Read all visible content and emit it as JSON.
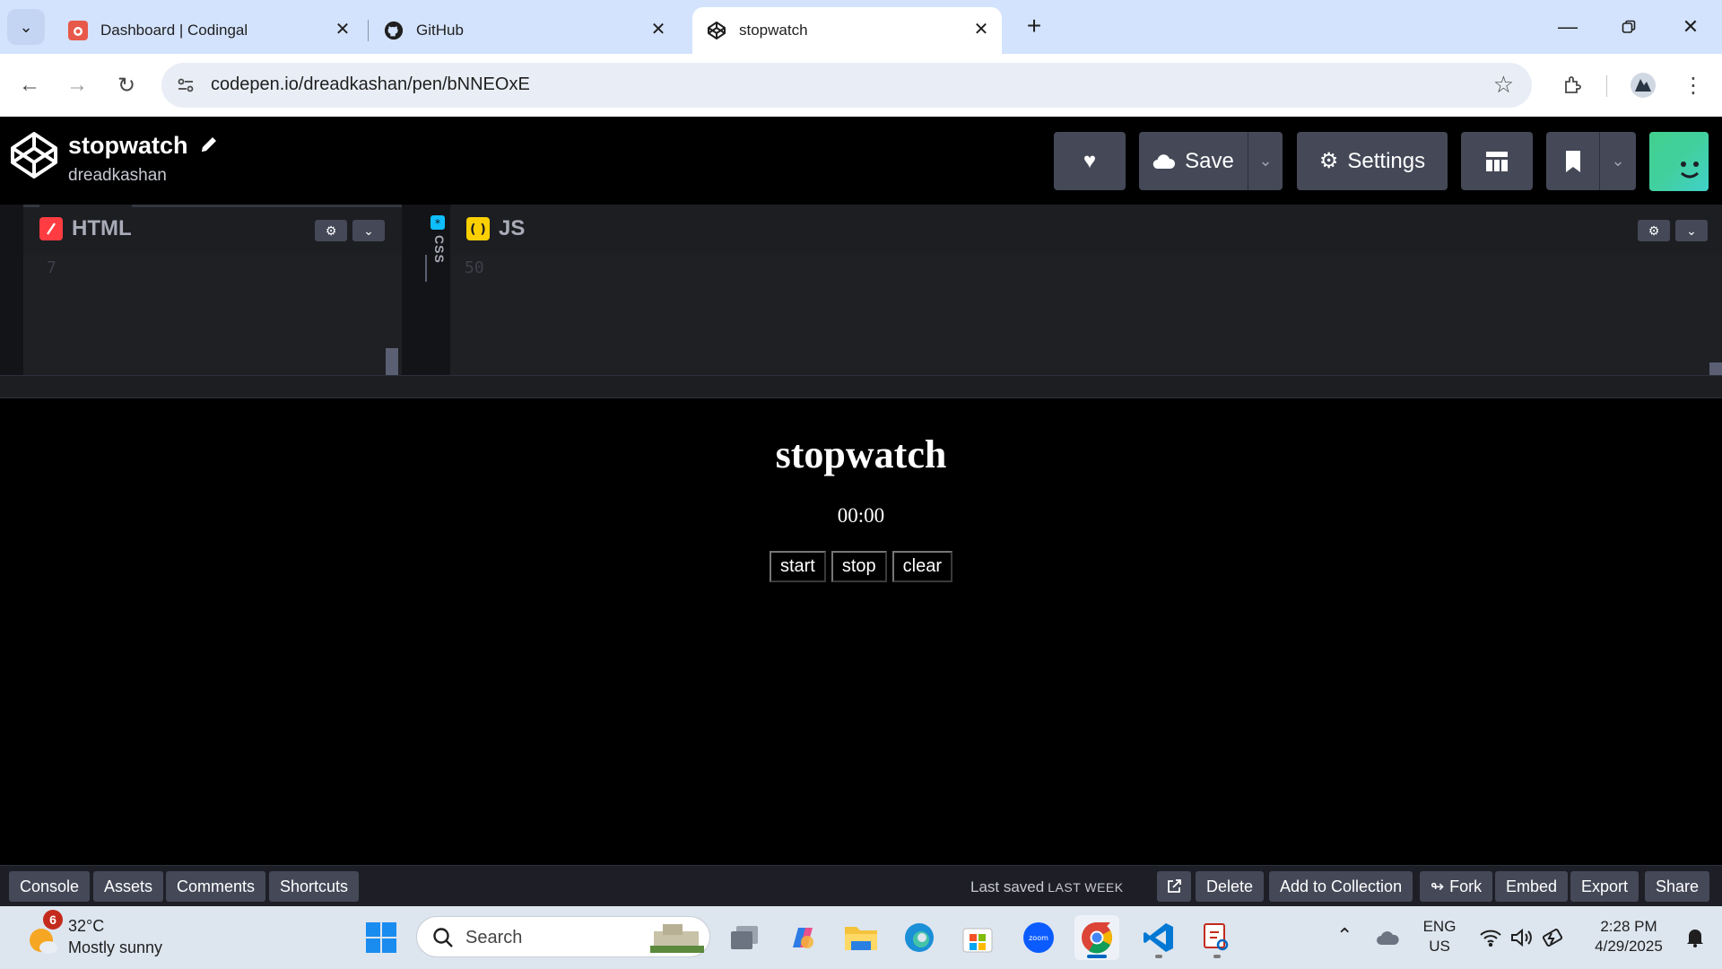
{
  "browser": {
    "tabs": [
      {
        "title": "Dashboard | Codingal",
        "icon": "codingal-icon"
      },
      {
        "title": "GitHub",
        "icon": "github-icon"
      },
      {
        "title": "stopwatch",
        "icon": "codepen-icon",
        "active": true
      }
    ],
    "url": "codepen.io/dreadkashan/pen/bNNEOxE"
  },
  "codepen": {
    "pen_title": "stopwatch",
    "author": "dreadkashan",
    "buttons": {
      "save": "Save",
      "settings": "Settings"
    },
    "editors": {
      "html": {
        "label": "HTML",
        "line_number": "7"
      },
      "css": {
        "label": "CSS"
      },
      "js": {
        "label": "JS",
        "line_number": "50"
      }
    },
    "footer": {
      "left": [
        "Console",
        "Assets",
        "Comments",
        "Shortcuts"
      ],
      "last_saved_label": "Last saved",
      "last_saved_value": "LAST WEEK",
      "right": [
        "Delete",
        "Add to Collection",
        "Fork",
        "Embed",
        "Export",
        "Share"
      ]
    }
  },
  "preview": {
    "heading": "stopwatch",
    "time": "00:00",
    "buttons": [
      "start",
      "stop",
      "clear"
    ]
  },
  "taskbar": {
    "weather": {
      "temp": "32°C",
      "condition": "Mostly sunny",
      "badge": "6"
    },
    "search_label": "Search",
    "language": [
      "ENG",
      "US"
    ],
    "time": "2:28 PM",
    "date": "4/29/2025"
  },
  "colors": {
    "chrome_tabstrip": "#d3e3fd",
    "codepen_bg": "#000000",
    "codepen_button": "#444857",
    "editor_bg": "#1d1e22",
    "taskbar": "#dde5ef"
  }
}
